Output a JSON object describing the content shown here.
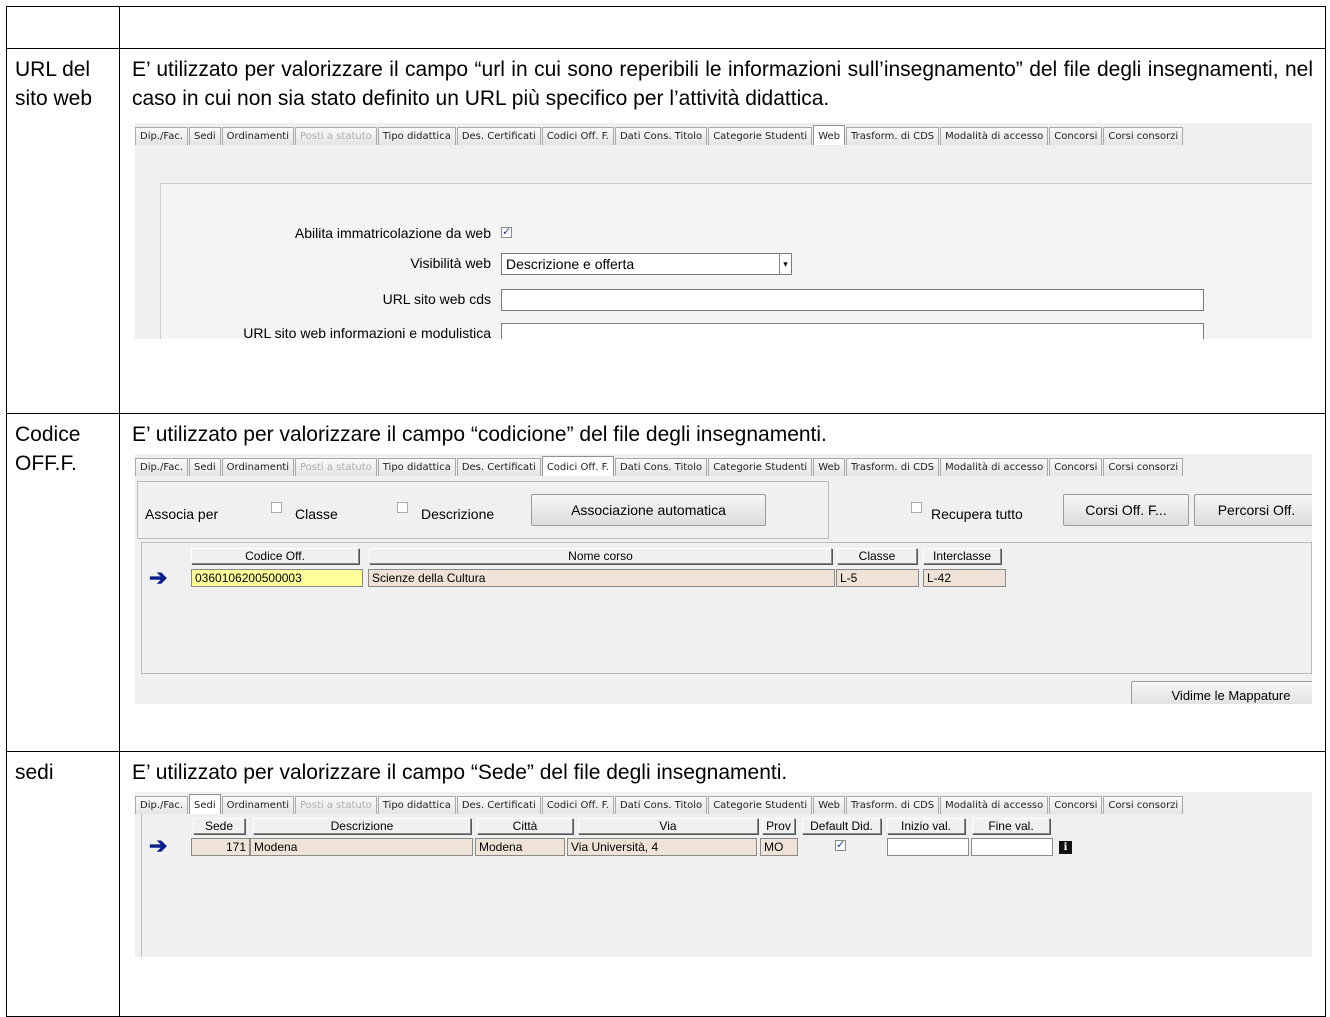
{
  "tabs": [
    {
      "label": "Dip./Fac.",
      "disabled": false
    },
    {
      "label": "Sedi",
      "disabled": false
    },
    {
      "label": "Ordinamenti",
      "disabled": false
    },
    {
      "label": "Posti a statuto",
      "disabled": true
    },
    {
      "label": "Tipo didattica",
      "disabled": false
    },
    {
      "label": "Des. Certificati",
      "disabled": false
    },
    {
      "label": "Codici Off. F.",
      "disabled": false
    },
    {
      "label": "Dati Cons. Titolo",
      "disabled": false
    },
    {
      "label": "Categorie Studenti",
      "disabled": false
    },
    {
      "label": "Web",
      "disabled": false
    },
    {
      "label": "Trasform. di CDS",
      "disabled": false
    },
    {
      "label": "Modalità di accesso",
      "disabled": false
    },
    {
      "label": "Concorsi",
      "disabled": false
    },
    {
      "label": "Corsi consorzi",
      "disabled": false
    }
  ],
  "rows": {
    "url": {
      "label": "URL del sito web",
      "text": "E’ utilizzato per valorizzare il campo “url in cui sono reperibili le informazioni sull’insegnamento” del file degli insegnamenti, nel caso in cui non sia stato definito un URL più specifico per l’attività didattica.",
      "active_tab": "Web",
      "fields": {
        "enable_label": "Abilita immatricolazione da web",
        "enable_checked": true,
        "visibility_label": "Visibilità web",
        "visibility_value": "Descrizione e offerta",
        "url_cds_label": "URL sito web cds",
        "url_cds_value": "",
        "url_info_label": "URL sito web informazioni e modulistica"
      }
    },
    "codice": {
      "label": "Codice OFF.F.",
      "text": "E’ utilizzato per valorizzare il campo “codicione” del file degli insegnamenti.",
      "active_tab": "Codici Off. F.",
      "associa_label": "Associa per",
      "classe_label": "Classe",
      "descrizione_label": "Descrizione",
      "auto_button": "Associazione automatica",
      "recupera_label": "Recupera tutto",
      "corsi_button": "Corsi Off. F...",
      "percorsi_button": "Percorsi Off.",
      "columns": [
        "Codice Off.",
        "Nome corso",
        "Classe",
        "Interclasse"
      ],
      "row": {
        "codice": "0360106200500003",
        "nome": "Scienze della Cultura",
        "classe": "L-5",
        "interclasse": "L-42"
      },
      "bottom_button": "Vidime le Mappature"
    },
    "sedi": {
      "label": "sedi",
      "text": "E’ utilizzato per valorizzare il campo “Sede” del file degli insegnamenti.",
      "active_tab": "Sedi",
      "columns": [
        "Sede",
        "Descrizione",
        "Città",
        "Via",
        "Prov",
        "Default Did.",
        "Inizio val.",
        "Fine val."
      ],
      "row": {
        "sede": "171",
        "descrizione": "Modena",
        "citta": "Modena",
        "via": "Via Università, 4",
        "prov": "MO",
        "default": true,
        "inizio": "",
        "fine": ""
      }
    }
  },
  "colors": {
    "accent": "#0a1f8a",
    "highlight": "#ffff99",
    "cell": "#efe2d6"
  },
  "icons": {
    "row_pointer": "arrow-right-icon",
    "info": "info-icon",
    "dropdown": "chevron-down-icon"
  }
}
